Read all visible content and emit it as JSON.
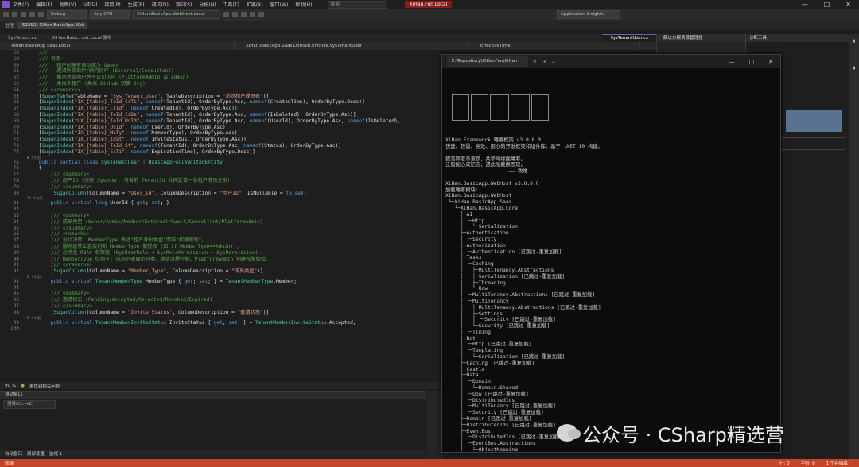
{
  "menubar": {
    "items": [
      "文件(F)",
      "编辑(E)",
      "视图(V)",
      "Git(G)",
      "项目(P)",
      "生成(B)",
      "调试(D)",
      "测试(S)",
      "分析(N)",
      "工具(T)",
      "扩展(X)",
      "窗口(W)",
      "帮助(H)"
    ],
    "search": "搜索",
    "window_title": "XiHan.Fun.Local"
  },
  "toolbar": {
    "config": "Debug",
    "platform": "Any CPU",
    "startup": "XiHan.BasicApp.WebHost.Local",
    "insights": "Application Insights"
  },
  "infobar": {
    "process_label": "进程:",
    "process": "[52252] XiHan.BasicApp.Web"
  },
  "tabs": [
    {
      "label": "SysTenant.cs",
      "active": false
    },
    {
      "label": "XiHan.Basic...ost.Local 发布",
      "active": false
    },
    {
      "label": "SysTenantUser.cs",
      "active": true
    }
  ],
  "navbar": {
    "project": "XiHan.BasicApp.Saas.Local",
    "class": "XiHan.BasicApp.Saas.Domain.Entities.SysTenantUser",
    "member": "EffectiveTime"
  },
  "code_lines": [
    {
      "n": "58",
      "t": [
        [
          "com",
          "    ///"
        ]
      ]
    },
    {
      "n": "59",
      "t": [
        [
          "com",
          "    /// 说明:"
        ]
      ]
    },
    {
      "n": "60",
      "t": [
        [
          "com",
          "    /// - 租户创建者自动成为 Owner"
        ]
      ]
    },
    {
      "n": "61",
      "t": [
        [
          "com",
          "    /// - 邀请外部伙伴/顾问协作 (External/Consultant)"
        ]
      ]
    },
    {
      "n": "62",
      "t": [
        [
          "com",
          "    /// - 集团总部用户跨子公司访问 (PlatformAdmin 或 Admin)"
        ]
      ]
    },
    {
      "n": "63",
      "t": [
        [
          "com",
          "    /// - 类似多租户 (类似 GitHub 切换 Org)"
        ]
      ]
    },
    {
      "n": "64",
      "t": [
        [
          "com",
          "    /// </remarks>"
        ]
      ]
    },
    {
      "n": "65",
      "t": [
        [
          "txt",
          "    ["
        ],
        [
          "attr",
          "SugarTable"
        ],
        [
          "txt",
          "(TableName = "
        ],
        [
          "str",
          "\"Sys_Tenant_User\""
        ],
        [
          "txt",
          ", TableDescription = "
        ],
        [
          "str",
          "\"系统租户成员表\""
        ],
        [
          "txt",
          ")]"
        ]
      ]
    },
    {
      "n": "66",
      "t": [
        [
          "txt",
          "    ["
        ],
        [
          "attr",
          "SugarIndex"
        ],
        [
          "txt",
          "("
        ],
        [
          "str",
          "\"IX_{table}_TeId_CrTi\""
        ],
        [
          "txt",
          ", "
        ],
        [
          "kw",
          "nameof"
        ],
        [
          "txt",
          "(TenantId), OrderByType.Asc, "
        ],
        [
          "kw",
          "nameof"
        ],
        [
          "txt",
          "(CreatedTime), OrderByType.Desc)]"
        ]
      ]
    },
    {
      "n": "67",
      "t": [
        [
          "txt",
          "    ["
        ],
        [
          "attr",
          "SugarIndex"
        ],
        [
          "txt",
          "("
        ],
        [
          "str",
          "\"IX_{table}_CrId\""
        ],
        [
          "txt",
          ", "
        ],
        [
          "kw",
          "nameof"
        ],
        [
          "txt",
          "(CreatedId), OrderByType.Asc)]"
        ]
      ]
    },
    {
      "n": "68",
      "t": [
        [
          "txt",
          "    ["
        ],
        [
          "attr",
          "SugarIndex"
        ],
        [
          "txt",
          "("
        ],
        [
          "str",
          "\"IX_{table}_TeId_IsDe\""
        ],
        [
          "txt",
          ", "
        ],
        [
          "kw",
          "nameof"
        ],
        [
          "txt",
          "(TenantId), OrderByType.Asc, "
        ],
        [
          "kw",
          "nameof"
        ],
        [
          "txt",
          "(IsDeleted), OrderByType.Asc)]"
        ]
      ]
    },
    {
      "n": "69",
      "t": [
        [
          "txt",
          "    ["
        ],
        [
          "attr",
          "SugarIndex"
        ],
        [
          "txt",
          "("
        ],
        [
          "str",
          "\"UX_{table}_TeId_UsId\""
        ],
        [
          "txt",
          ", "
        ],
        [
          "kw",
          "nameof"
        ],
        [
          "txt",
          "(TenantId), OrderByType.Asc, "
        ],
        [
          "kw",
          "nameof"
        ],
        [
          "txt",
          "(UserId), OrderByType.Asc, "
        ],
        [
          "kw",
          "nameof"
        ],
        [
          "txt",
          "(IsDeleted), "
        ]
      ]
    },
    {
      "n": "70",
      "t": [
        [
          "txt",
          "    ["
        ],
        [
          "attr",
          "SugarIndex"
        ],
        [
          "txt",
          "("
        ],
        [
          "str",
          "\"IX_{table}_UsId\""
        ],
        [
          "txt",
          ", "
        ],
        [
          "kw",
          "nameof"
        ],
        [
          "txt",
          "(UserId), OrderByType.Asc)]"
        ]
      ]
    },
    {
      "n": "71",
      "t": [
        [
          "txt",
          "    ["
        ],
        [
          "attr",
          "SugarIndex"
        ],
        [
          "txt",
          "("
        ],
        [
          "str",
          "\"IX_{table}_MeTy\""
        ],
        [
          "txt",
          ", "
        ],
        [
          "kw",
          "nameof"
        ],
        [
          "txt",
          "(MemberType), OrderByType.Asc)]"
        ]
      ]
    },
    {
      "n": "72",
      "t": [
        [
          "txt",
          "    ["
        ],
        [
          "attr",
          "SugarIndex"
        ],
        [
          "txt",
          "("
        ],
        [
          "str",
          "\"IX_{table}_InSt\""
        ],
        [
          "txt",
          ", "
        ],
        [
          "kw",
          "nameof"
        ],
        [
          "txt",
          "(InviteStatus), OrderByType.Asc)]"
        ]
      ]
    },
    {
      "n": "73",
      "t": [
        [
          "txt",
          "    ["
        ],
        [
          "attr",
          "SugarIndex"
        ],
        [
          "txt",
          "("
        ],
        [
          "str",
          "\"IX_{table}_TeId_St\""
        ],
        [
          "txt",
          ", "
        ],
        [
          "kw",
          "nameof"
        ],
        [
          "txt",
          "(TenantId), OrderByType.Asc, "
        ],
        [
          "kw",
          "nameof"
        ],
        [
          "txt",
          "(Status), OrderByType.Asc)]"
        ]
      ]
    },
    {
      "n": "74",
      "t": [
        [
          "txt",
          "    ["
        ],
        [
          "attr",
          "SugarIndex"
        ],
        [
          "txt",
          "("
        ],
        [
          "str",
          "\"IX_{table}_ExTi\""
        ],
        [
          "txt",
          ", "
        ],
        [
          "kw",
          "nameof"
        ],
        [
          "txt",
          "(ExpirationTime), OrderByType.Desc)]"
        ]
      ],
      "lens": "0 个引用"
    },
    {
      "n": "75",
      "t": [
        [
          "kw",
          "    public partial class "
        ],
        [
          "typ",
          "SysTenantUser"
        ],
        [
          "txt",
          " : "
        ],
        [
          "typ",
          "BasicAppFullAuditedEntity"
        ]
      ]
    },
    {
      "n": "76",
      "t": [
        [
          "txt",
          "    {"
        ]
      ]
    },
    {
      "n": "77",
      "t": [
        [
          "com",
          "        /// <summary>"
        ]
      ]
    },
    {
      "n": "78",
      "t": [
        [
          "com",
          "        /// 用户ID (关联 SysUser, 与当前 TenantId 共同定位一条租户成员关系)"
        ]
      ]
    },
    {
      "n": "79",
      "t": [
        [
          "com",
          "        /// </summary>"
        ]
      ]
    },
    {
      "n": "80",
      "t": [
        [
          "txt",
          "        ["
        ],
        [
          "attr",
          "SugarColumn"
        ],
        [
          "txt",
          "(ColumnName = "
        ],
        [
          "str",
          "\"User_Id\""
        ],
        [
          "txt",
          ", ColumnDescription = "
        ],
        [
          "str",
          "\"用户ID\""
        ],
        [
          "txt",
          ", IsNullable = "
        ],
        [
          "kw",
          "false"
        ],
        [
          "txt",
          ")]"
        ]
      ],
      "lens": "16 个引用"
    },
    {
      "n": "81",
      "t": [
        [
          "kw",
          "        public virtual long "
        ],
        [
          "txt",
          "UserId { "
        ],
        [
          "kw",
          "get"
        ],
        [
          "txt",
          "; "
        ],
        [
          "kw",
          "set"
        ],
        [
          "txt",
          "; }"
        ]
      ]
    },
    {
      "n": "82",
      "t": [
        [
          "txt",
          ""
        ]
      ]
    },
    {
      "n": "83",
      "t": [
        [
          "com",
          "        /// <summary>"
        ]
      ]
    },
    {
      "n": "84",
      "t": [
        [
          "com",
          "        /// 成员类型 (Owner/Admin/Member/External/Guest/Consultant/PlatformAdmin)"
        ]
      ]
    },
    {
      "n": "85",
      "t": [
        [
          "com",
          "        /// </summary>"
        ]
      ]
    },
    {
      "n": "86",
      "t": [
        [
          "com",
          "        /// <remarks>"
        ]
      ]
    },
    {
      "n": "87",
      "t": [
        [
          "com",
          "        /// 设计决策: MemberType 表达\"租户身份类型\"而非\"权限级别\"。"
        ]
      ]
    },
    {
      "n": "88",
      "t": [
        [
          "com",
          "        /// 服务层禁止直接判断 MemberType 做授权 (如 if MemberType==Admin) ,"
        ]
      ]
    },
    {
      "n": "89",
      "t": [
        [
          "com",
          "        /// 必须走 RBAC 权限链 (SysUserRole + SysRolePermission + SysPermission) 。"
        ]
      ]
    },
    {
      "n": "90",
      "t": [
        [
          "com",
          "        /// MemberType 仅用于: 成员列表展示分类、邀请流程控制、PlatformAdmin 创建权限校验。"
        ]
      ]
    },
    {
      "n": "91",
      "t": [
        [
          "com",
          "        /// </remarks>"
        ]
      ]
    },
    {
      "n": "92",
      "t": [
        [
          "txt",
          "        ["
        ],
        [
          "attr",
          "SugarColumn"
        ],
        [
          "txt",
          "(ColumnName = "
        ],
        [
          "str",
          "\"Member_Type\""
        ],
        [
          "txt",
          ", ColumnDescription = "
        ],
        [
          "str",
          "\"成员类型\""
        ],
        [
          "txt",
          ")]"
        ]
      ],
      "lens": "8 个引用"
    },
    {
      "n": "93",
      "t": [
        [
          "kw",
          "        public virtual "
        ],
        [
          "typ",
          "TenantMemberType"
        ],
        [
          "txt",
          " MemberType { "
        ],
        [
          "kw",
          "get"
        ],
        [
          "txt",
          "; "
        ],
        [
          "kw",
          "set"
        ],
        [
          "txt",
          "; } = "
        ],
        [
          "typ",
          "TenantMemberType"
        ],
        [
          "txt",
          ".Member;"
        ]
      ]
    },
    {
      "n": "94",
      "t": [
        [
          "txt",
          ""
        ]
      ]
    },
    {
      "n": "95",
      "t": [
        [
          "com",
          "        /// <summary>"
        ]
      ]
    },
    {
      "n": "96",
      "t": [
        [
          "com",
          "        /// 邀请状态 (Pending/Accepted/Rejected/Revoked/Expired)"
        ]
      ]
    },
    {
      "n": "97",
      "t": [
        [
          "com",
          "        /// </summary>"
        ]
      ]
    },
    {
      "n": "98",
      "t": [
        [
          "txt",
          "        ["
        ],
        [
          "attr",
          "SugarColumn"
        ],
        [
          "txt",
          "(ColumnName = "
        ],
        [
          "str",
          "\"Invite_Status\""
        ],
        [
          "txt",
          ", ColumnDescription = "
        ],
        [
          "str",
          "\"邀请状态\""
        ],
        [
          "txt",
          ")]"
        ]
      ],
      "lens": "9 个引用"
    },
    {
      "n": "99",
      "t": [
        [
          "kw",
          "        public virtual "
        ],
        [
          "typ",
          "TenantMemberInviteStatus"
        ],
        [
          "txt",
          " InviteStatus { "
        ],
        [
          "kw",
          "get"
        ],
        [
          "txt",
          "; "
        ],
        [
          "kw",
          "set"
        ],
        [
          "txt",
          "; } = "
        ],
        [
          "typ",
          "TenantMemberInviteStatus"
        ],
        [
          "txt",
          ".Accepted;"
        ]
      ]
    },
    {
      "n": "100",
      "t": [
        [
          "txt",
          ""
        ]
      ]
    }
  ],
  "zoombar": {
    "zoom": "90 %",
    "issues": "未找到相关问题"
  },
  "bottompanel": {
    "title": "自动窗口",
    "search": "搜索(Ctrl+E)",
    "tabs": [
      "自动窗口",
      "局部变量",
      "监视 1"
    ]
  },
  "statusbar": {
    "left": "就绪",
    "right": [
      "行: 0",
      "字符: 0",
      "1 个存储库"
    ]
  },
  "rightpanel": {
    "title": "解决方案资源管理器"
  },
  "diagpanel": {
    "title": "诊断工具"
  },
  "terminal": {
    "tab_title": "E:\\Repository\\XiHanFun\\XiHan",
    "lines": [
      "XiHan.Framework 曦寒框架 v3.0.0.0",
      "快速、轻量、高效、用心的开发框架和组件库。基于 .NET 10 构建。",
      "",
      "碧落降恩承淑颜，共挚崎缘挽曦寒。",
      "迁般痴心成忆念，遗此凯戴换思现。",
      "                     —— 致她",
      "",
      "XiHan.BasicApp.WebHost v3.0.0.0",
      "加载曦寒模块:",
      "XiHan.BasicApp.WebHost",
      " └─XiHan.BasicApp.Saas",
      "   └─XiHan.BasicApp.Core",
      "     ├─AI",
      "     │ └─Http",
      "     │   └─Serialization",
      "     ├─Authentication",
      "     │ └─Security",
      "     ├─Authorization",
      "     │ └─Authentication [已跳过-重复加载]",
      "     ├─Tasks",
      "     │ ├─Caching",
      "     │ │ ├─MultiTenancy.Abstractions",
      "     │ │ ├─Serialization [已跳过-重复加载]",
      "     │ │ ├─Threading",
      "     │ │ └─Uow",
      "     │ ├─MultiTenancy.Abstractions [已跳过-重复加载]",
      "     │ ├─MultiTenancy",
      "     │ │ ├─MultiTenancy.Abstractions [已跳过-重复加载]",
      "     │ │ ├─Settings",
      "     │ │ │ └─Security [已跳过-重复加载]",
      "     │ │ └─Security [已跳过-重复加载]",
      "     │ └─Timing",
      "     ├─Bot",
      "     │ ├─Http [已跳过-重复加载]",
      "     │ └─Templating",
      "     │   └─Serialization [已跳过-重复加载]",
      "     ├─Caching [已跳过-重复加载]",
      "     ├─Castle",
      "     ├─Data",
      "     │ ├─Domain",
      "     │ │ └─Domain.Shared",
      "     │ ├─Uow [已跳过-重复加载]",
      "     │ ├─DistributedIds",
      "     │ ├─MultiTenancy [已跳过-重复加载]",
      "     │ └─Security [已跳过-重复加载]",
      "     ├─Domain [已跳过-重复加载]",
      "     ├─DistributedIds [已跳过-重复加载]",
      "     ├─EventBus",
      "     │ ├─DistributedIds [已跳过-重复加载]",
      "     │ ├─EventBus.Abstractions",
      "     │ │ └─ObjectMapping",
      "     │ │   ├─Localization.Abstrac",
      "     │ │   └─Validation.Abstrac"
    ]
  },
  "watermark": {
    "text": "公众号 · CSharp精选营"
  },
  "colors": {
    "accent": "#7f52c7",
    "status": "#c5452a",
    "comment": "#57a64a",
    "keyword": "#569cd6",
    "type": "#4ec9b0",
    "string": "#d69d85"
  }
}
